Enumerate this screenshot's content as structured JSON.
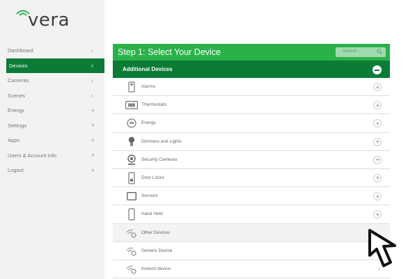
{
  "brand": {
    "logo_text": "vera"
  },
  "sidebar": {
    "items": [
      {
        "label": "Dashboard",
        "chevron": "›",
        "active": false
      },
      {
        "label": "Devices",
        "chevron": "›",
        "active": true
      },
      {
        "label": "Cameras",
        "chevron": "›",
        "active": false
      },
      {
        "label": "Scenes",
        "chevron": "›",
        "active": false
      },
      {
        "label": "Energy",
        "chevron": "+",
        "active": false
      },
      {
        "label": "Settings",
        "chevron": "+",
        "active": false
      },
      {
        "label": "Apps",
        "chevron": "+",
        "active": false
      },
      {
        "label": "Users & Account Info",
        "chevron": "+",
        "active": false
      },
      {
        "label": "Logout",
        "chevron": "+",
        "active": false
      }
    ]
  },
  "main": {
    "title": "Step 1: Select Your Device",
    "search_placeholder": "Search",
    "section_title": "Additional Devices",
    "devices": [
      {
        "label": "Alarms",
        "icon": "alarm-panel-icon"
      },
      {
        "label": "Thermostats",
        "icon": "thermostat-icon"
      },
      {
        "label": "Energy",
        "icon": "energy-meter-icon"
      },
      {
        "label": "Dimmers and Lights",
        "icon": "light-bulb-icon"
      },
      {
        "label": "Security Cameras",
        "icon": "security-camera-icon"
      },
      {
        "label": "Door Locks",
        "icon": "door-lock-icon"
      },
      {
        "label": "Sensors",
        "icon": "sensor-icon"
      },
      {
        "label": "Hand Held",
        "icon": "handheld-remote-icon"
      },
      {
        "label": "Other Devices",
        "icon": "wireless-device-icon"
      },
      {
        "label": "Generic Device",
        "icon": "wireless-device-icon"
      },
      {
        "label": "Insteon device",
        "icon": "wireless-device-icon"
      }
    ]
  },
  "colors": {
    "accent": "#2bb14a",
    "accent_dark": "#0b7b36",
    "sidebar_bg": "#f2f2f2"
  }
}
